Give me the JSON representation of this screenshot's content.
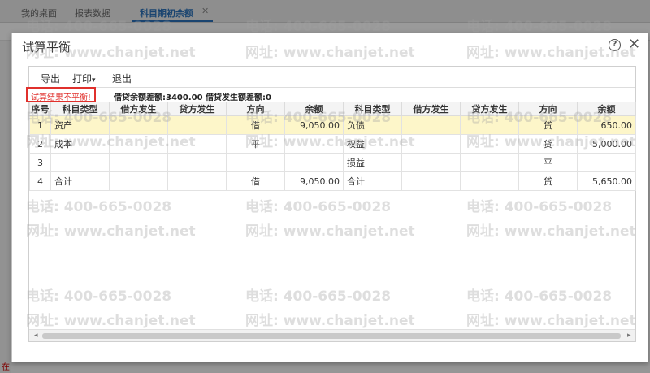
{
  "background": {
    "tabs": [
      "我的桌面",
      "报表数据",
      "科目期初余额"
    ],
    "close_glyph": "✕",
    "bottom_text": "在"
  },
  "dialog": {
    "title": "试算平衡",
    "help_glyph": "?",
    "close_glyph": "✕",
    "menu": {
      "export": "导出",
      "print": "打印",
      "print_caret": "▾",
      "exit": "退出"
    },
    "status_badge": "试算结果不平衡!",
    "status_text": "借贷余额差额:3400.00 借贷发生额差额:0",
    "headers": [
      "序号",
      "科目类型",
      "借方发生",
      "贷方发生",
      "方向",
      "余额",
      "科目类型",
      "借方发生",
      "贷方发生",
      "方向",
      "余额"
    ],
    "rows": [
      [
        "1",
        "资产",
        "",
        "",
        "借",
        "9,050.00",
        "负债",
        "",
        "",
        "贷",
        "650.00"
      ],
      [
        "2",
        "成本",
        "",
        "",
        "平",
        "",
        "权益",
        "",
        "",
        "贷",
        "5,000.00"
      ],
      [
        "3",
        "",
        "",
        "",
        "",
        "",
        "损益",
        "",
        "",
        "平",
        ""
      ],
      [
        "4",
        "合计",
        "",
        "",
        "借",
        "9,050.00",
        "合计",
        "",
        "",
        "贷",
        "5,650.00"
      ]
    ],
    "scroll_left": "◂",
    "scroll_right": "▸"
  },
  "watermark": {
    "phone": "电话: 400-665-0028",
    "site": "网址: www.chanjet.net"
  },
  "colors": {
    "accent": "#2a6fb5",
    "alert": "#e0302c",
    "highlight_row": "#fdf6c9"
  }
}
